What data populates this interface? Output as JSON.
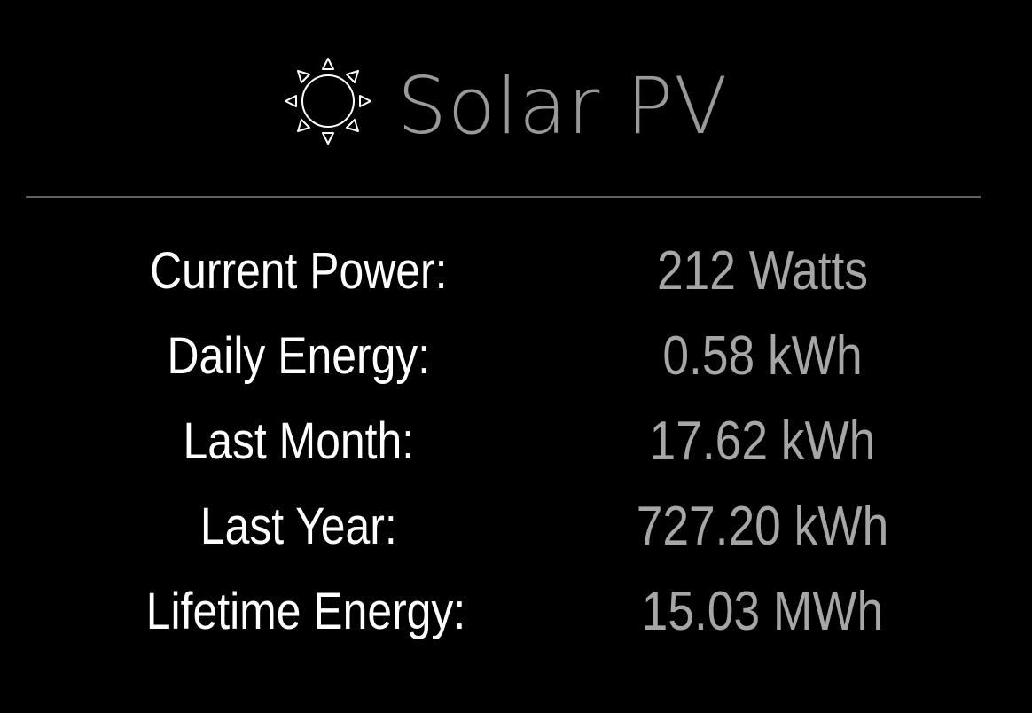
{
  "header": {
    "icon": "sun-icon",
    "title": "Solar PV"
  },
  "stats": [
    {
      "label": "Current Power:",
      "value": "212 Watts"
    },
    {
      "label": "Daily Energy:",
      "value": "0.58 kWh"
    },
    {
      "label": "Last Month:",
      "value": "17.62 kWh"
    },
    {
      "label": "Last Year:",
      "value": "727.20 kWh"
    },
    {
      "label": "Lifetime Energy:",
      "value": "15.03 MWh"
    }
  ],
  "colors": {
    "background": "#000000",
    "title": "#999999",
    "label": "#ffffff",
    "value": "#a6a6a6",
    "divider": "#5f5f5f"
  }
}
